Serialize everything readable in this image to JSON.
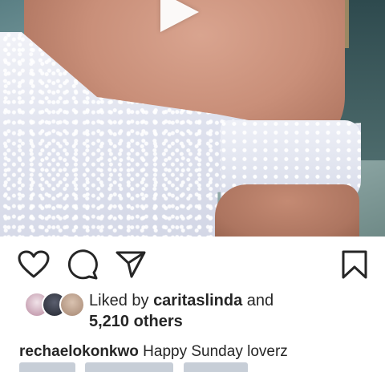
{
  "post": {
    "media": {
      "description_type": "video",
      "play_icon": "play-icon"
    },
    "actions": {
      "like_icon": "heart-icon",
      "comment_icon": "comment-icon",
      "share_icon": "send-icon",
      "save_icon": "bookmark-icon"
    },
    "likes": {
      "prefix": "Liked by",
      "user": "caritaslinda",
      "conjunction": "and",
      "others": "5,210 others"
    },
    "caption": {
      "username": "rechaelokonkwo",
      "text": "Happy Sunday loverz"
    }
  },
  "colors": {
    "text": "#262626",
    "background": "#ffffff"
  }
}
